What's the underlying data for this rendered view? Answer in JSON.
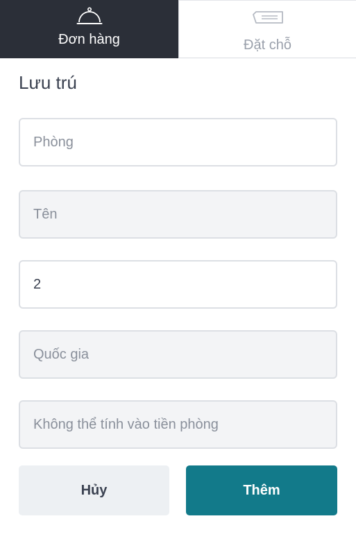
{
  "tabs": {
    "orders": {
      "label": "Đơn hàng",
      "icon": "cloche-icon",
      "active": true
    },
    "reservations": {
      "label": "Đặt chỗ",
      "icon": "ticket-icon",
      "active": false
    }
  },
  "form": {
    "title": "Lưu trú",
    "fields": [
      {
        "placeholder": "Phòng",
        "value": ""
      },
      {
        "placeholder": "Tên",
        "value": ""
      },
      {
        "placeholder": "",
        "value": "2"
      },
      {
        "placeholder": "Quốc gia",
        "value": ""
      },
      {
        "placeholder": "Không thể tính vào tiền phòng",
        "value": ""
      }
    ]
  },
  "actions": {
    "cancel_label": "Hủy",
    "add_label": "Thêm"
  },
  "colors": {
    "tab_active_bg": "#2b2f38",
    "primary": "#127a8a",
    "secondary_bg": "#edf0f3"
  }
}
